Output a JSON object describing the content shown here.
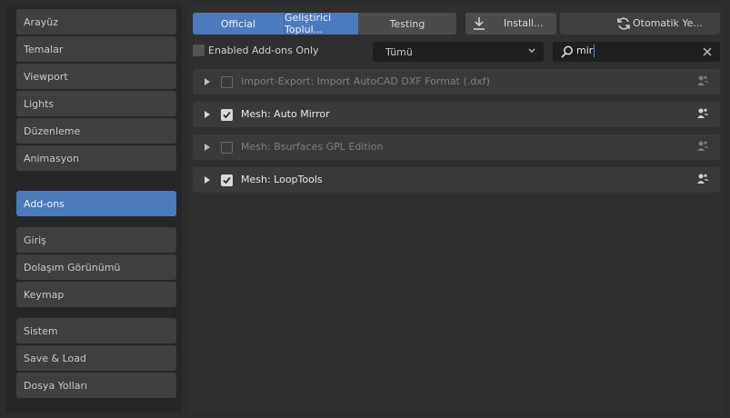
{
  "sidebar": {
    "groups": [
      [
        "Arayüz",
        "Temalar",
        "Viewport",
        "Lights",
        "Düzenleme",
        "Animasyon"
      ],
      [
        "Add-ons"
      ],
      [
        "Giriş",
        "Dolaşım Görünümü",
        "Keymap"
      ],
      [
        "Sistem",
        "Save & Load",
        "Dosya Yolları"
      ]
    ],
    "active": "Add-ons"
  },
  "toolbar": {
    "tabs": [
      "Official",
      "Geliştirici Toplul...",
      "Testing"
    ],
    "active_tabs": [
      "Official",
      "Geliştirici Toplul..."
    ],
    "install_label": "Install...",
    "install_icon": "download-icon",
    "refresh_label": "Otomatik Ye...",
    "refresh_icon": "refresh-icon"
  },
  "filters": {
    "enabled_only_label": "Enabled Add-ons Only",
    "enabled_only_checked": false,
    "category_value": "Tümü",
    "search_value": "mir",
    "search_icon": "search-icon",
    "clear_icon": "close-icon"
  },
  "addons": [
    {
      "name": "Import-Export: Import AutoCAD DXF Format (.dxf)",
      "enabled": false
    },
    {
      "name": "Mesh: Auto Mirror",
      "enabled": true
    },
    {
      "name": "Mesh: Bsurfaces GPL Edition",
      "enabled": false
    },
    {
      "name": "Mesh: LoopTools",
      "enabled": true
    }
  ],
  "colors": {
    "accent": "#4a7bbf",
    "panel": "#3a3a3a",
    "background": "#2f2f2f"
  }
}
